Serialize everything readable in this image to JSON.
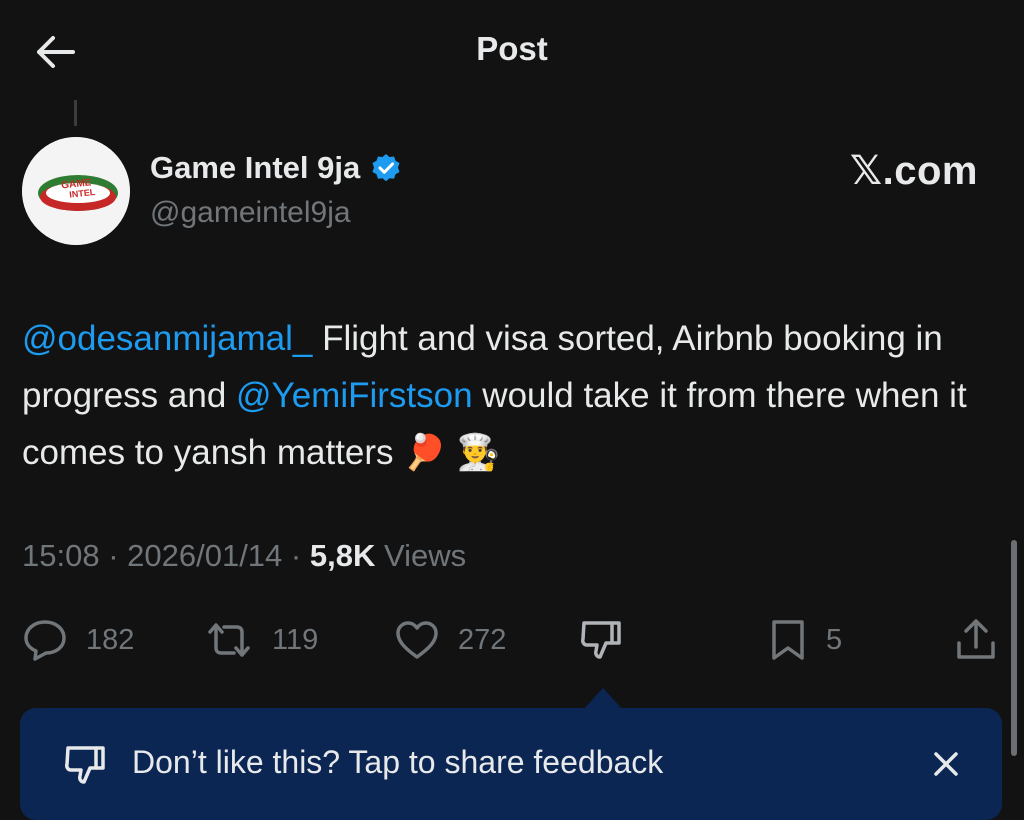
{
  "header": {
    "title": "Post"
  },
  "author": {
    "display_name": "Game Intel 9ja",
    "handle": "@gameintel9ja",
    "verified": true,
    "avatar_logo_text": "GAME INTEL"
  },
  "brand_label": "𝕏.com",
  "tweet": {
    "mention_1": "@odesanmijamal_",
    "text_1": " Flight and visa sorted, Airbnb booking in progress and ",
    "mention_2": "@YemiFirstson",
    "text_2": " would take it from there when it comes to yansh matters ",
    "emojis": "🏓 👨‍🍳"
  },
  "meta": {
    "time": "15:08",
    "separator_1": " · ",
    "date": "2026/01/14",
    "separator_2": " · ",
    "views_count": "5,8K",
    "views_label": " Views"
  },
  "actions": {
    "replies": "182",
    "reposts": "119",
    "likes": "272",
    "bookmarks": "5"
  },
  "feedback_banner": {
    "text": "Don’t like this? Tap to share feedback"
  },
  "colors": {
    "background": "#121212",
    "accent": "#1d9bf0",
    "banner": "#0c2653",
    "muted": "#71767b"
  }
}
